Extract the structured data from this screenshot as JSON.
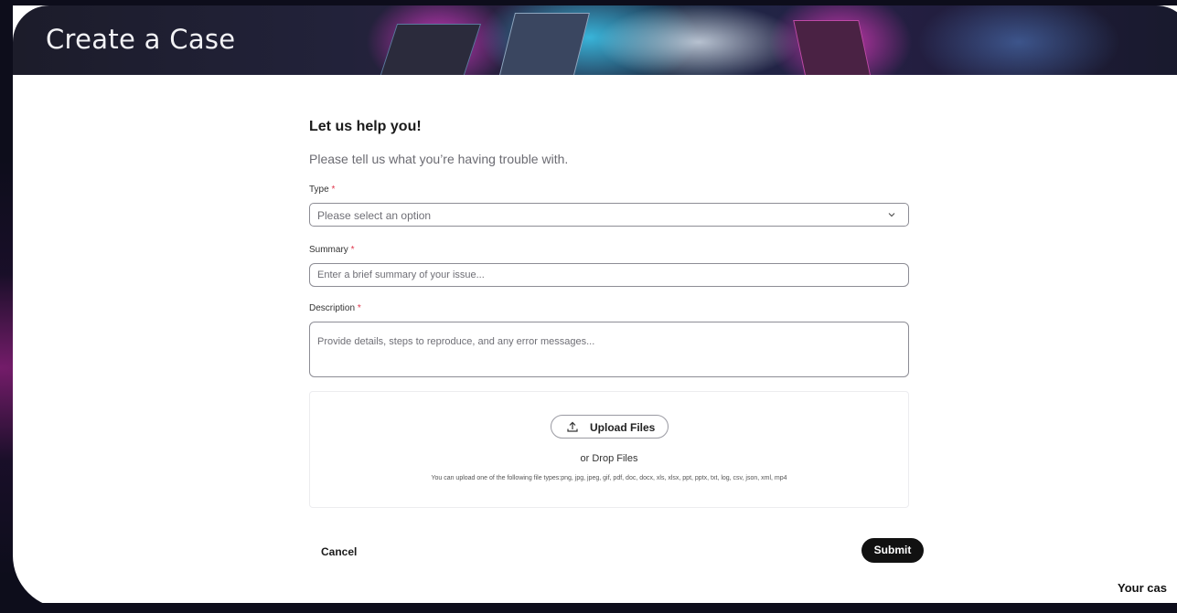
{
  "page": {
    "title": "Create a Case",
    "footer_text": "Your cas"
  },
  "form": {
    "heading": "Let us help you!",
    "subtext": "Please tell us what you’re having trouble with.",
    "type": {
      "label": "Type",
      "required_mark": "*",
      "placeholder": "Please select an option"
    },
    "summary": {
      "label": "Summary",
      "required_mark": "*",
      "placeholder": "Enter a brief summary of your issue..."
    },
    "description": {
      "label": "Description",
      "required_mark": "*",
      "placeholder": "Provide details, steps to reproduce, and any error messages..."
    },
    "upload": {
      "button_label": "Upload Files",
      "drop_label": "or Drop Files",
      "file_types_note": "You can upload one of the following file types:png, jpg, jpeg, gif, pdf, doc, docx, xls, xlsx, ppt, pptx, txt, log, csv, json, xml, mp4"
    },
    "actions": {
      "cancel_label": "Cancel",
      "submit_label": "Submit"
    }
  },
  "icons": {
    "select_chevron": "chevron-down-icon",
    "upload": "upload-icon"
  },
  "colors": {
    "required": "#e0344a",
    "submit_bg": "#111111",
    "banner_accent_pink": "#e23bd0",
    "banner_accent_cyan": "#3fd8ff"
  }
}
